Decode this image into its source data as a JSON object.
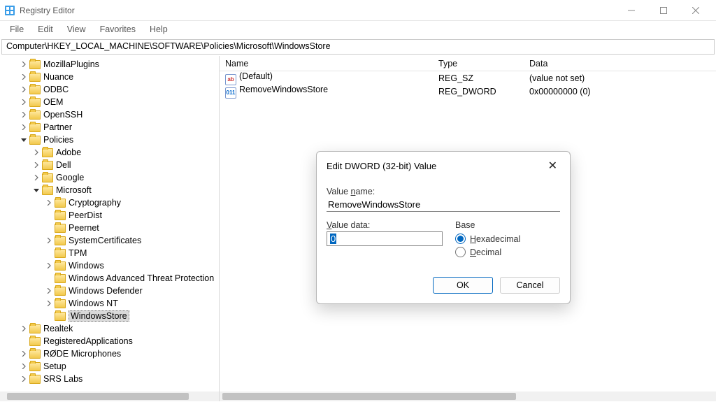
{
  "app": {
    "title": "Registry Editor"
  },
  "menu": {
    "file": "File",
    "edit": "Edit",
    "view": "View",
    "favorites": "Favorites",
    "help": "Help"
  },
  "address": "Computer\\HKEY_LOCAL_MACHINE\\SOFTWARE\\Policies\\Microsoft\\WindowsStore",
  "tree": {
    "items": [
      {
        "depth": 2,
        "expander": ">",
        "label": "MozillaPlugins"
      },
      {
        "depth": 2,
        "expander": ">",
        "label": "Nuance"
      },
      {
        "depth": 2,
        "expander": ">",
        "label": "ODBC"
      },
      {
        "depth": 2,
        "expander": ">",
        "label": "OEM"
      },
      {
        "depth": 2,
        "expander": ">",
        "label": "OpenSSH"
      },
      {
        "depth": 2,
        "expander": ">",
        "label": "Partner"
      },
      {
        "depth": 2,
        "expander": "v",
        "label": "Policies"
      },
      {
        "depth": 3,
        "expander": ">",
        "label": "Adobe"
      },
      {
        "depth": 3,
        "expander": ">",
        "label": "Dell"
      },
      {
        "depth": 3,
        "expander": ">",
        "label": "Google"
      },
      {
        "depth": 3,
        "expander": "v",
        "label": "Microsoft"
      },
      {
        "depth": 4,
        "expander": ">",
        "label": "Cryptography"
      },
      {
        "depth": 4,
        "expander": "",
        "label": "PeerDist"
      },
      {
        "depth": 4,
        "expander": "",
        "label": "Peernet"
      },
      {
        "depth": 4,
        "expander": ">",
        "label": "SystemCertificates"
      },
      {
        "depth": 4,
        "expander": "",
        "label": "TPM"
      },
      {
        "depth": 4,
        "expander": ">",
        "label": "Windows"
      },
      {
        "depth": 4,
        "expander": "",
        "label": "Windows Advanced Threat Protection"
      },
      {
        "depth": 4,
        "expander": ">",
        "label": "Windows Defender"
      },
      {
        "depth": 4,
        "expander": ">",
        "label": "Windows NT"
      },
      {
        "depth": 4,
        "expander": "",
        "label": "WindowsStore",
        "selected": true
      },
      {
        "depth": 2,
        "expander": ">",
        "label": "Realtek"
      },
      {
        "depth": 2,
        "expander": "",
        "label": "RegisteredApplications"
      },
      {
        "depth": 2,
        "expander": ">",
        "label": "RØDE Microphones"
      },
      {
        "depth": 2,
        "expander": ">",
        "label": "Setup"
      },
      {
        "depth": 2,
        "expander": ">",
        "label": "SRS Labs"
      }
    ]
  },
  "list": {
    "headers": {
      "name": "Name",
      "type": "Type",
      "data": "Data"
    },
    "rows": [
      {
        "icon": "str",
        "iconText": "ab",
        "name": "(Default)",
        "type": "REG_SZ",
        "data": "(value not set)"
      },
      {
        "icon": "dw",
        "iconText": "011",
        "name": "RemoveWindowsStore",
        "type": "REG_DWORD",
        "data": "0x00000000 (0)"
      }
    ]
  },
  "dialog": {
    "title": "Edit DWORD (32-bit) Value",
    "valueNameLabel": "Value name:",
    "valueName": "RemoveWindowsStore",
    "valueDataLabel": "Value data:",
    "valueData": "0",
    "baseLabel": "Base",
    "hexLabel": "Hexadecimal",
    "decLabel": "Decimal",
    "ok": "OK",
    "cancel": "Cancel"
  }
}
